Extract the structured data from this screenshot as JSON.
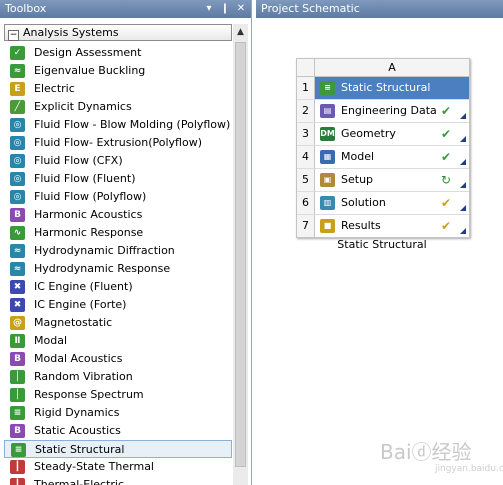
{
  "toolbox": {
    "title": "Toolbox",
    "pin_label": "▾",
    "dock_label": "❙",
    "close_label": "✕",
    "group": {
      "toggle": "−",
      "label": "Analysis Systems"
    },
    "items": [
      {
        "label": "Design Assessment",
        "icon": "design-assessment-icon",
        "color": "#3a9a3a",
        "glyph": "✓"
      },
      {
        "label": "Eigenvalue Buckling",
        "icon": "eigenvalue-buckling-icon",
        "color": "#3a9a3a",
        "glyph": "≈"
      },
      {
        "label": "Electric",
        "icon": "electric-icon",
        "color": "#c9a019",
        "glyph": "E"
      },
      {
        "label": "Explicit Dynamics",
        "icon": "explicit-dynamics-icon",
        "color": "#4a9a3a",
        "glyph": "╱"
      },
      {
        "label": "Fluid Flow - Blow Molding (Polyflow)",
        "icon": "fluid-flow-icon",
        "color": "#2a86a8",
        "glyph": "◎"
      },
      {
        "label": "Fluid Flow- Extrusion(Polyflow)",
        "icon": "fluid-flow-icon",
        "color": "#2a86a8",
        "glyph": "◎"
      },
      {
        "label": "Fluid Flow (CFX)",
        "icon": "fluid-flow-icon",
        "color": "#2a86a8",
        "glyph": "◎"
      },
      {
        "label": "Fluid Flow (Fluent)",
        "icon": "fluid-flow-icon",
        "color": "#2a86a8",
        "glyph": "◎"
      },
      {
        "label": "Fluid Flow (Polyflow)",
        "icon": "fluid-flow-icon",
        "color": "#2a86a8",
        "glyph": "◎"
      },
      {
        "label": "Harmonic Acoustics",
        "icon": "harmonic-acoustics-icon",
        "color": "#8a4ab0",
        "glyph": "B"
      },
      {
        "label": "Harmonic Response",
        "icon": "harmonic-response-icon",
        "color": "#3a9a3a",
        "glyph": "∿"
      },
      {
        "label": "Hydrodynamic Diffraction",
        "icon": "hydrodynamic-diffraction-icon",
        "color": "#2a86a8",
        "glyph": "≈"
      },
      {
        "label": "Hydrodynamic Response",
        "icon": "hydrodynamic-response-icon",
        "color": "#2a86a8",
        "glyph": "≈"
      },
      {
        "label": "IC Engine (Fluent)",
        "icon": "ic-engine-icon",
        "color": "#3a4ab0",
        "glyph": "✖"
      },
      {
        "label": "IC Engine (Forte)",
        "icon": "ic-engine-icon",
        "color": "#3a4ab0",
        "glyph": "✖"
      },
      {
        "label": "Magnetostatic",
        "icon": "magnetostatic-icon",
        "color": "#c9a019",
        "glyph": "@"
      },
      {
        "label": "Modal",
        "icon": "modal-icon",
        "color": "#3a9a3a",
        "glyph": "Ⅱ"
      },
      {
        "label": "Modal Acoustics",
        "icon": "modal-acoustics-icon",
        "color": "#8a4ab0",
        "glyph": "B"
      },
      {
        "label": "Random Vibration",
        "icon": "random-vibration-icon",
        "color": "#3a9a3a",
        "glyph": "│"
      },
      {
        "label": "Response Spectrum",
        "icon": "response-spectrum-icon",
        "color": "#3a9a3a",
        "glyph": "│"
      },
      {
        "label": "Rigid Dynamics",
        "icon": "rigid-dynamics-icon",
        "color": "#3a9a3a",
        "glyph": "≡"
      },
      {
        "label": "Static Acoustics",
        "icon": "static-acoustics-icon",
        "color": "#8a4ab0",
        "glyph": "B"
      },
      {
        "label": "Static Structural",
        "icon": "static-structural-icon",
        "color": "#3a9a3a",
        "glyph": "≡",
        "selected": true
      },
      {
        "label": "Steady-State Thermal",
        "icon": "steady-state-thermal-icon",
        "color": "#c03a3a",
        "glyph": "┃"
      },
      {
        "label": "Thermal-Electric",
        "icon": "thermal-electric-icon",
        "color": "#c03a3a",
        "glyph": "┃"
      }
    ]
  },
  "scrollbar": {
    "up": "▲",
    "down": "▼"
  },
  "schematic": {
    "title": "Project Schematic",
    "column_label": "A",
    "rows": [
      {
        "num": "1",
        "label": "Static Structural",
        "icon": "static-structural-icon",
        "color": "#3a9a3a",
        "glyph": "≡",
        "state": "",
        "state_color": "#000000",
        "header": true
      },
      {
        "num": "2",
        "label": "Engineering Data",
        "icon": "engineering-data-icon",
        "color": "#6a5ab0",
        "glyph": "▤",
        "state": "✔",
        "state_color": "#3a9a3a"
      },
      {
        "num": "3",
        "label": "Geometry",
        "icon": "geometry-icon",
        "color": "#2a7a3a",
        "glyph": "DM",
        "state": "✔",
        "state_color": "#3a9a3a"
      },
      {
        "num": "4",
        "label": "Model",
        "icon": "model-icon",
        "color": "#3a6ab0",
        "glyph": "▦",
        "state": "✔",
        "state_color": "#3a9a3a"
      },
      {
        "num": "5",
        "label": "Setup",
        "icon": "setup-icon",
        "color": "#b08a3a",
        "glyph": "▣",
        "state": "↻",
        "state_color": "#2e8b2e"
      },
      {
        "num": "6",
        "label": "Solution",
        "icon": "solution-icon",
        "color": "#3a8ab0",
        "glyph": "▥",
        "state": "✔",
        "state_color": "#c9a019"
      },
      {
        "num": "7",
        "label": "Results",
        "icon": "results-icon",
        "color": "#c9a019",
        "glyph": "■",
        "state": "✔",
        "state_color": "#c9a019"
      }
    ],
    "system_label": "Static Structural"
  },
  "watermark": {
    "text": "Baiⓓ经验",
    "sub": "jingyan.baidu.com"
  }
}
